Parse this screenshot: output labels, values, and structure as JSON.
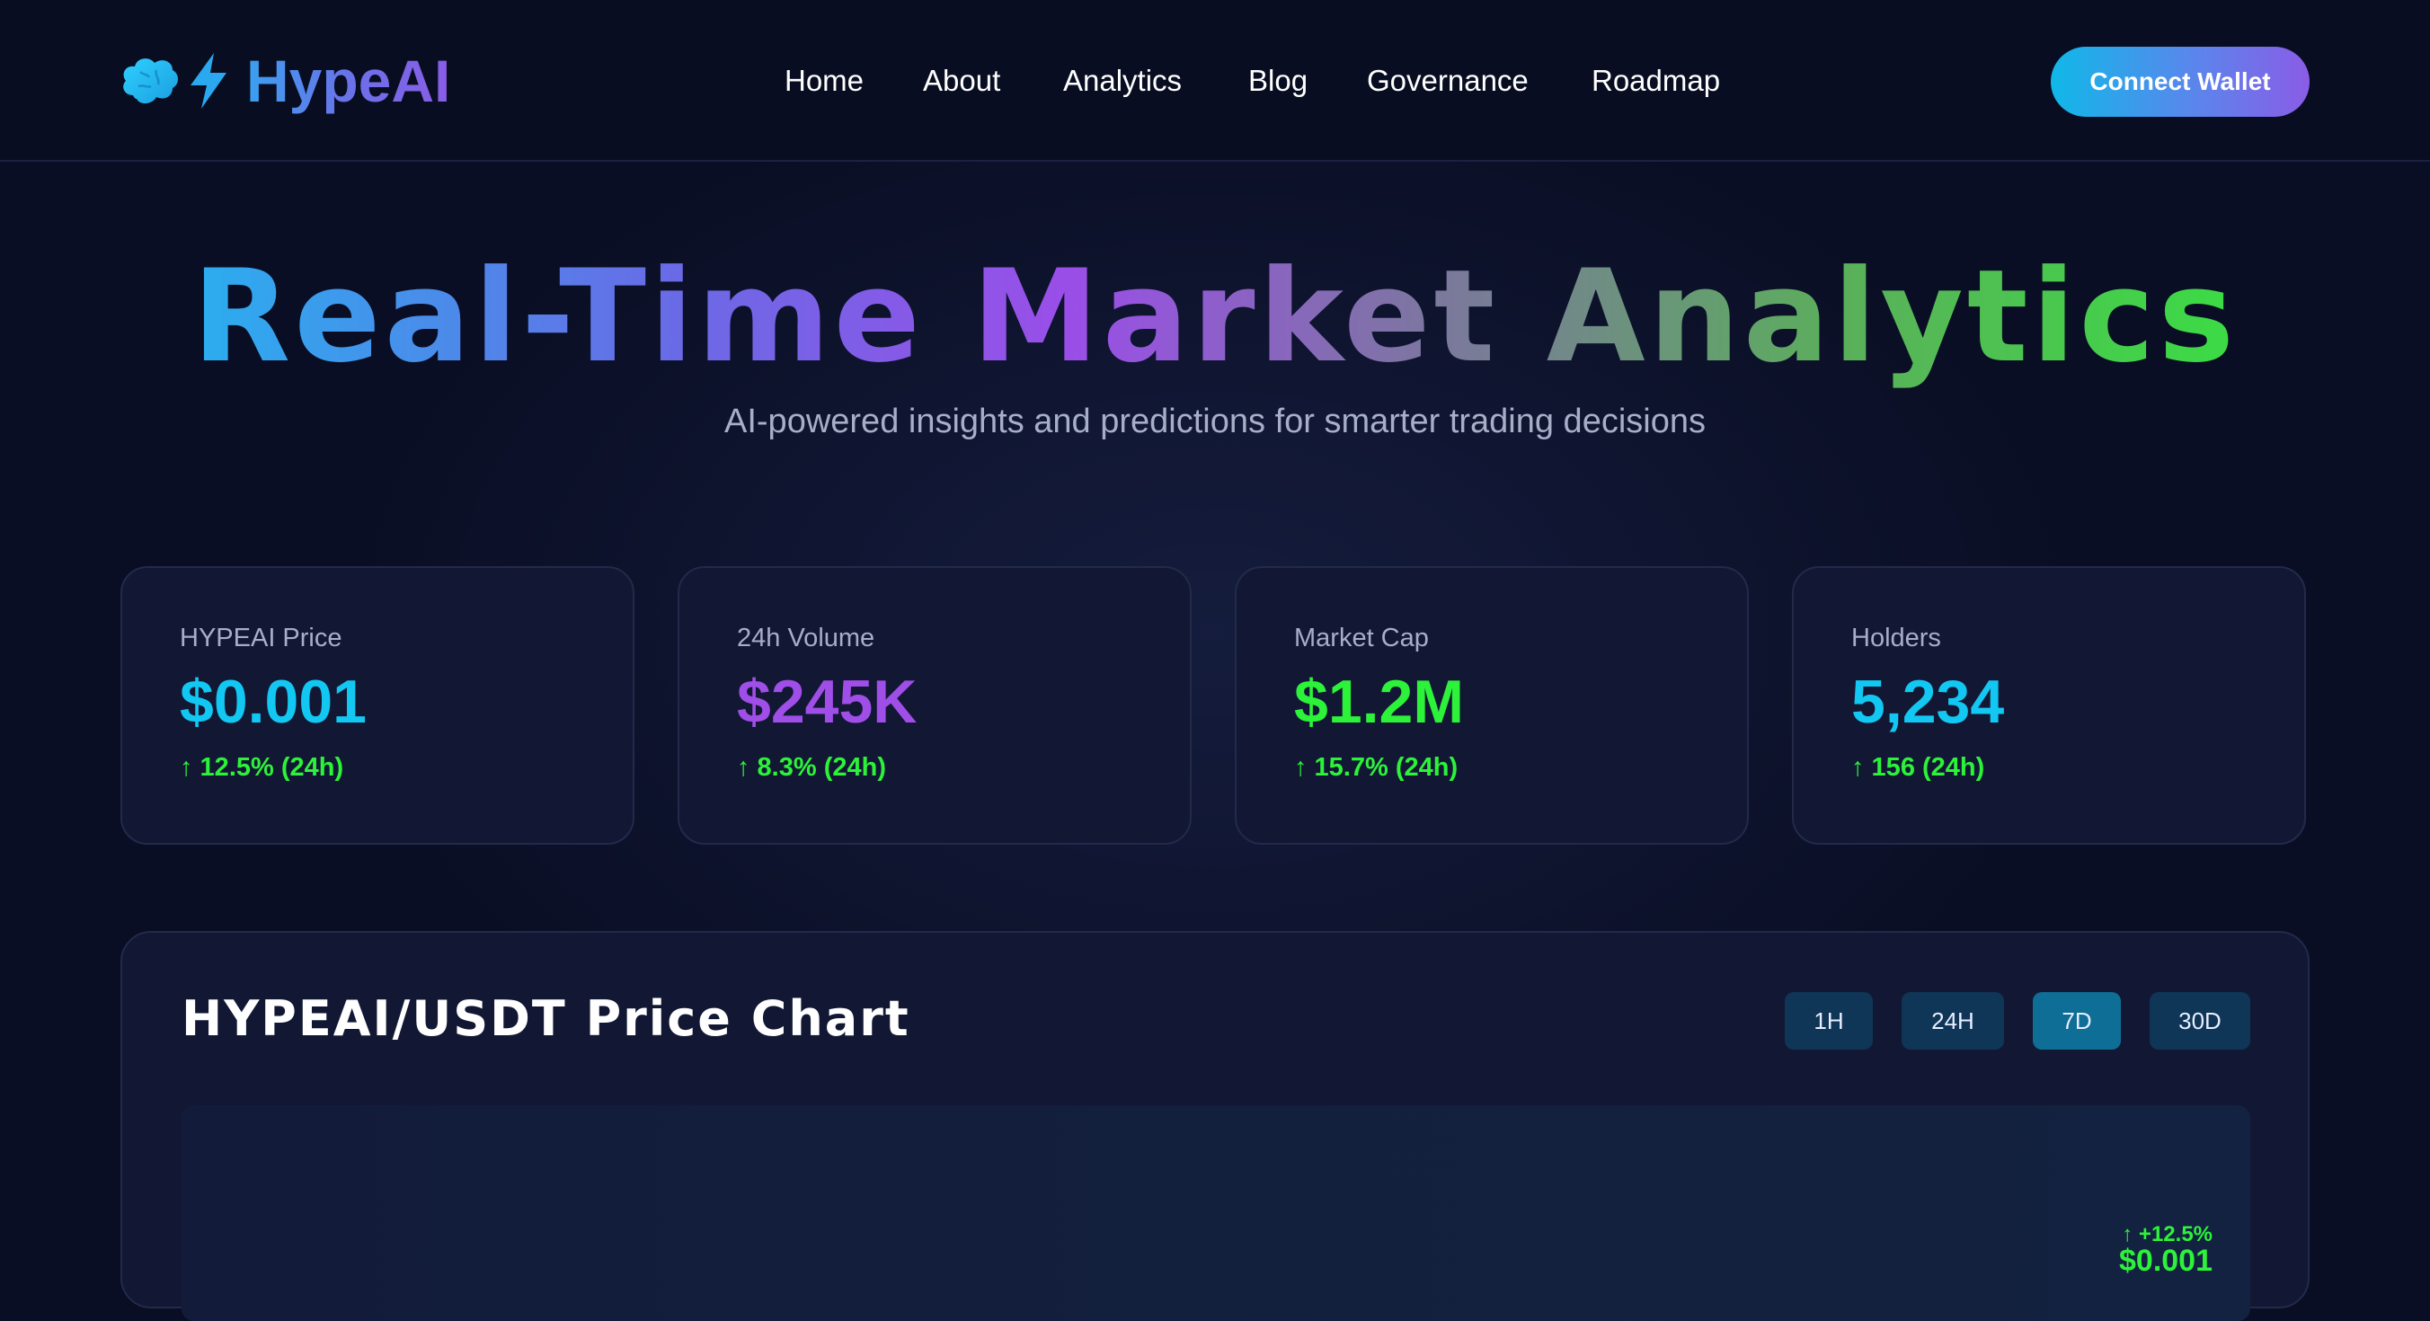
{
  "brand": {
    "name": "HypeAI",
    "logo_icons": [
      "brain-icon",
      "lightning-bolt-icon"
    ]
  },
  "nav": {
    "items": [
      {
        "label": "Home"
      },
      {
        "label": "About"
      },
      {
        "label": "Analytics"
      },
      {
        "label": "Blog"
      },
      {
        "label": "Governance"
      },
      {
        "label": "Roadmap"
      }
    ],
    "connect_label": "Connect Wallet"
  },
  "hero": {
    "title": "Real-Time Market Analytics",
    "subtitle": "AI-powered insights and predictions for smarter trading decisions"
  },
  "stats": [
    {
      "label": "HYPEAI Price",
      "value": "$0.001",
      "change": "↑ 12.5% (24h)",
      "color": "#12c8f2"
    },
    {
      "label": "24h Volume",
      "value": "$245K",
      "change": "↑ 8.3% (24h)",
      "color": "#a04ee8"
    },
    {
      "label": "Market Cap",
      "value": "$1.2M",
      "change": "↑ 15.7% (24h)",
      "color": "#2cf23a"
    },
    {
      "label": "Holders",
      "value": "5,234",
      "change": "↑ 156 (24h)",
      "color": "#12c8f2"
    }
  ],
  "chart": {
    "title": "HYPEAI/USDT Price Chart",
    "timeframes": [
      {
        "label": "1H",
        "active": false
      },
      {
        "label": "24H",
        "active": false
      },
      {
        "label": "7D",
        "active": true
      },
      {
        "label": "30D",
        "active": false
      }
    ],
    "latest_change": "↑ +12.5%",
    "latest_price": "$0.001"
  },
  "colors": {
    "accent_cyan": "#12c8f2",
    "accent_purple": "#9a4ee8",
    "accent_green": "#2cf23a",
    "background": "#0a0e24",
    "card": "#121834"
  }
}
